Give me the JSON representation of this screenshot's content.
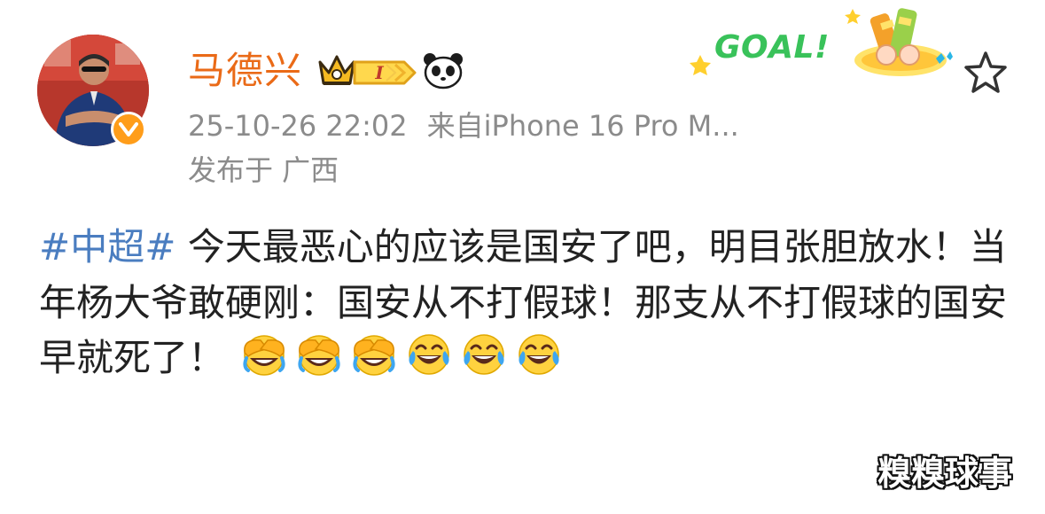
{
  "post": {
    "username": "马德兴",
    "level": "I",
    "timestamp": "25-10-26 22:02",
    "source": "来自iPhone 16 Pro M...",
    "location": "发布于 广西",
    "hashtag": "#中超#",
    "text": " 今天最恶心的应该是国安了吧，明目张胆放水！当年杨大爷敢硬刚：国安从不打假球！那支从不打假球的国安早就死了！",
    "emojis": [
      "facepalm-laugh-icon",
      "facepalm-laugh-icon",
      "facepalm-laugh-icon",
      "tears-of-joy-icon",
      "tears-of-joy-icon",
      "tears-of-joy-icon"
    ]
  },
  "card": {
    "goal_label": "GOAL!"
  },
  "watermark": {
    "text": "糗糗球事"
  },
  "colors": {
    "username": "#ea6a17",
    "hashtag": "#4a7dc0",
    "meta": "#8b8b8b",
    "verify": "#ff9d1a",
    "goal": "#39c25a"
  }
}
